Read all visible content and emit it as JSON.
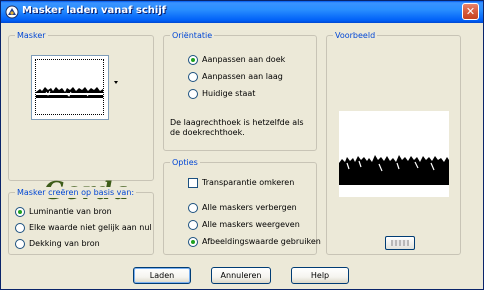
{
  "window": {
    "title": "Masker laden vanaf schijf",
    "close_glyph": "✕"
  },
  "mask_group": {
    "legend": "Masker",
    "logo_text": "Gerda"
  },
  "orientation_group": {
    "legend": "Oriëntatie",
    "options": [
      {
        "label": "Aanpassen aan doek",
        "selected": true
      },
      {
        "label": "Aanpassen aan laag",
        "selected": false
      },
      {
        "label": "Huidige staat",
        "selected": false
      }
    ],
    "info": "De laagrechthoek is hetzelfde als de doekrechthoek."
  },
  "source_group": {
    "legend": "Masker creëren op basis van:",
    "options": [
      {
        "label": "Luminantie van bron",
        "selected": true
      },
      {
        "label": "Elke waarde niet gelijk aan nul",
        "selected": false
      },
      {
        "label": "Dekking van bron",
        "selected": false
      }
    ]
  },
  "options_group": {
    "legend": "Opties",
    "invert_label": "Transparantie omkeren",
    "invert_checked": false,
    "options": [
      {
        "label": "Alle maskers verbergen",
        "selected": false
      },
      {
        "label": "Alle maskers weergeven",
        "selected": false
      },
      {
        "label": "Afbeeldingswaarde gebruiken",
        "selected": true
      }
    ]
  },
  "preview_group": {
    "legend": "Voorbeeld"
  },
  "buttons": {
    "load": "Laden",
    "cancel": "Annuleren",
    "help": "Help"
  },
  "colors": {
    "titlebar": "#0058EE",
    "dialog_bg": "#ECE9D8",
    "legend_text": "#0046D5",
    "radio_dot": "#21A121",
    "logo_green": "#3E5C1A"
  }
}
